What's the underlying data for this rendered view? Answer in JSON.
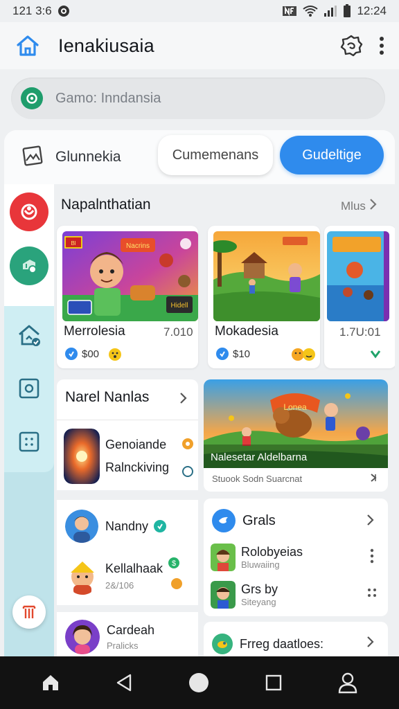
{
  "status": {
    "time_left": "121 3:6",
    "clock": "12:24"
  },
  "appbar": {
    "title": "Ienakiusaia"
  },
  "search": {
    "placeholder": "Gamo: Inndansia"
  },
  "tabs": {
    "first": "Glunnekia",
    "second": "Cumemenans",
    "active": "Gudeltige"
  },
  "section1": {
    "title": "Napalnthatian",
    "more": "Mlus",
    "games": [
      {
        "name": "Merrolesia",
        "score": "7.010",
        "price": "$00"
      },
      {
        "name": "Mokadesia",
        "score": "",
        "price": "$10"
      },
      {
        "name": "",
        "score": "1.7U:01",
        "price": ""
      }
    ],
    "game1_art_text": {
      "sign": "Nacrins",
      "top": "Bl",
      "box": "Hidell"
    }
  },
  "section2": {
    "title": "Narel Nanlas",
    "items": [
      {
        "line1": "Genoiande",
        "line2": "Ralnckiving"
      },
      {
        "line1": "Nandny",
        "line2": ""
      },
      {
        "line1": "Kellalhaak",
        "line2": "2&/106"
      },
      {
        "line1": "Cardeah",
        "line2": "Pralicks"
      }
    ]
  },
  "feature": {
    "banner_caption": "Nalesetar Aldelbarna",
    "banner_sign": "Lonea",
    "subtitle": "Stuook Sodn Suarcnat"
  },
  "grals": {
    "title": "Grals",
    "items": [
      {
        "name": "Rolobyeias",
        "sub": "Bluwaiing"
      },
      {
        "name": "Grs by",
        "sub": "Siteyang"
      }
    ]
  },
  "bottom_card": {
    "title": "Frreg daatloes:"
  }
}
